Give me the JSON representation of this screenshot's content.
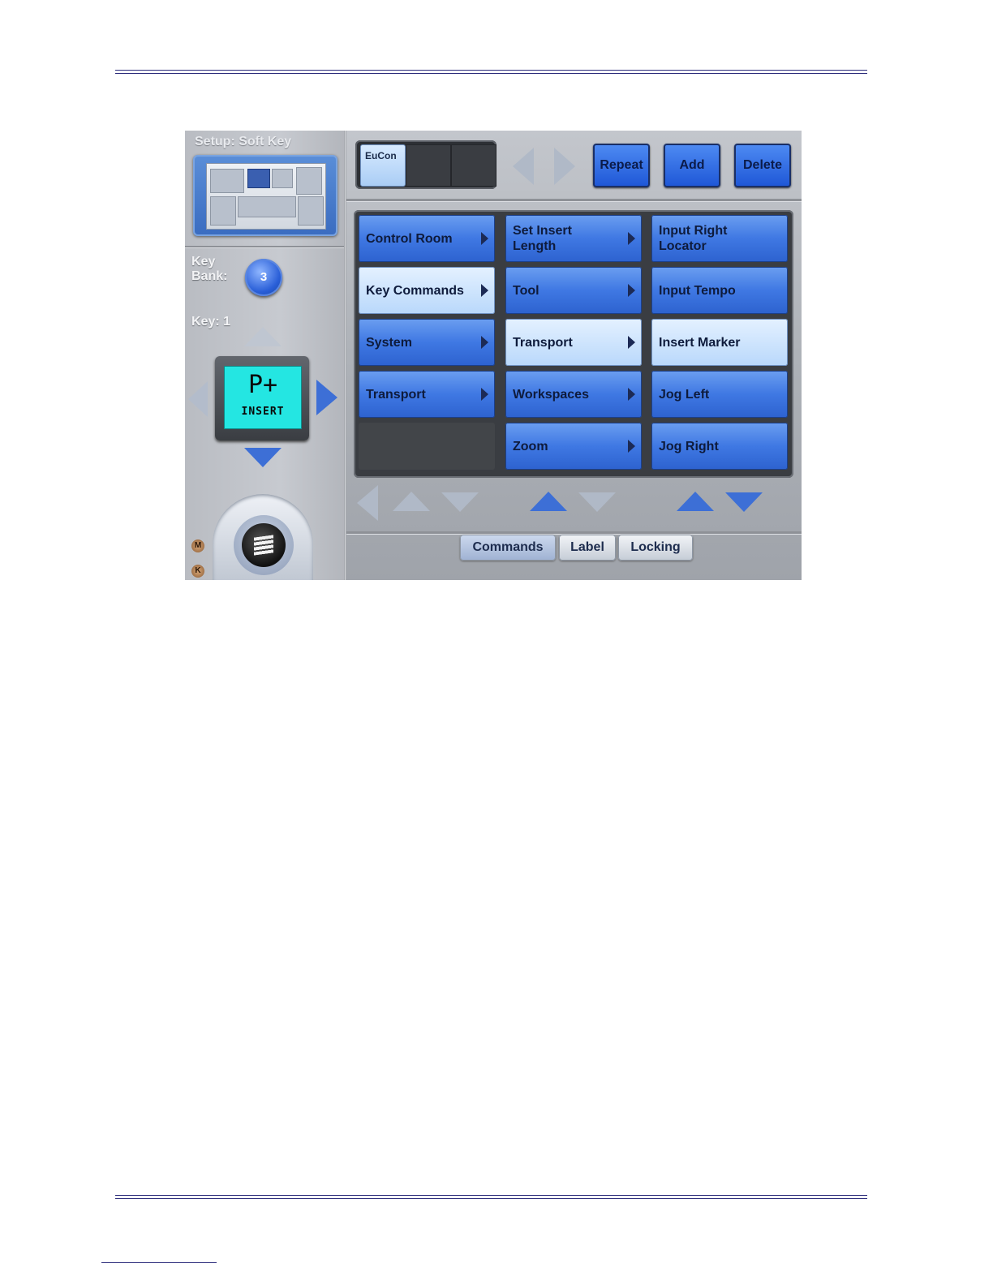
{
  "setup": {
    "title": "Setup:  Soft Key"
  },
  "key_bank": {
    "label_line1": "Key",
    "label_line2": "Bank:",
    "value": "3"
  },
  "key": {
    "label": "Key:  1",
    "display_glyph": "P+",
    "display_text": "INSERT",
    "display_color": "#24e6e2"
  },
  "device_slots": [
    {
      "label": "EuCon"
    },
    {
      "label": ""
    },
    {
      "label": ""
    }
  ],
  "toolbar": {
    "repeat_label": "Repeat",
    "add_label": "Add",
    "delete_label": "Delete"
  },
  "columns": [
    {
      "items": [
        {
          "label": "Control Room",
          "submenu": true,
          "selected": false
        },
        {
          "label": "Key Commands",
          "submenu": true,
          "selected": true
        },
        {
          "label": "System",
          "submenu": true,
          "selected": false
        },
        {
          "label": "Transport",
          "submenu": true,
          "selected": false
        },
        {
          "label": "",
          "empty": true
        }
      ]
    },
    {
      "items": [
        {
          "label": "Set Insert\nLength",
          "submenu": true,
          "selected": false
        },
        {
          "label": "Tool",
          "submenu": true,
          "selected": false
        },
        {
          "label": "Transport",
          "submenu": true,
          "selected": true
        },
        {
          "label": "Workspaces",
          "submenu": true,
          "selected": false
        },
        {
          "label": "Zoom",
          "submenu": true,
          "selected": false
        }
      ]
    },
    {
      "items": [
        {
          "label": "Input Right\nLocator",
          "submenu": false,
          "selected": false
        },
        {
          "label": "Input Tempo",
          "submenu": false,
          "selected": false
        },
        {
          "label": "Insert Marker",
          "submenu": false,
          "selected": true
        },
        {
          "label": "Jog Left",
          "submenu": false,
          "selected": false
        },
        {
          "label": "Jog Right",
          "submenu": false,
          "selected": false
        }
      ]
    }
  ],
  "tabs": [
    {
      "label": "Commands",
      "active": true
    },
    {
      "label": "Label",
      "active": false
    },
    {
      "label": "Locking",
      "active": false
    }
  ],
  "indicators": {
    "m": "M",
    "k": "K"
  },
  "colors": {
    "button_blue": "#3f78e3",
    "selected": "#b9d8fb",
    "panel_gray": "#b3b6bc"
  }
}
